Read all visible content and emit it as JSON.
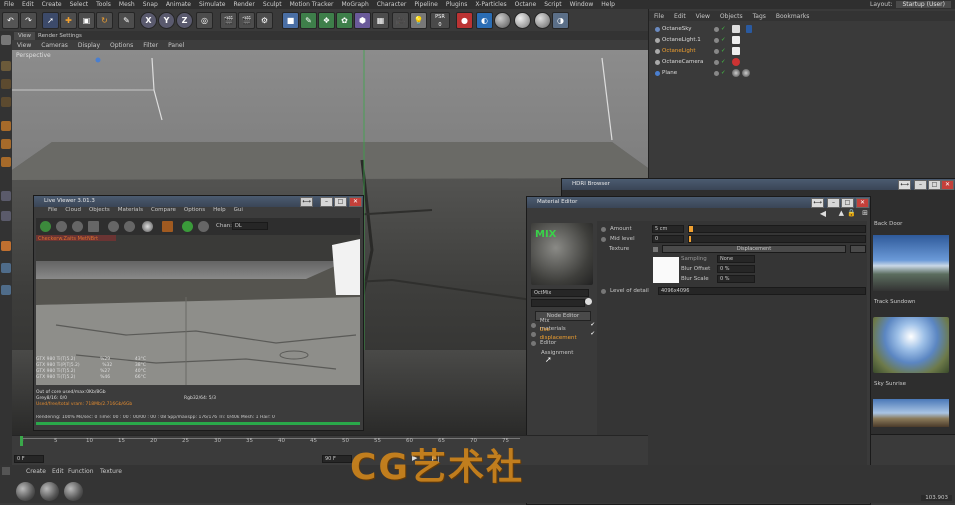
{
  "menubar": {
    "items": [
      "File",
      "Edit",
      "Create",
      "Select",
      "Tools",
      "Mesh",
      "Snap",
      "Animate",
      "Simulate",
      "Render",
      "Sculpt",
      "Motion Tracker",
      "MoGraph",
      "Character",
      "Pipeline",
      "Plugins",
      "X-Particles",
      "Octane",
      "Script",
      "Window",
      "Help"
    ],
    "layout_label": "Layout:",
    "layout_value": "Startup (User)"
  },
  "toolbar": {
    "axis_x": "X",
    "axis_y": "Y",
    "axis_z": "Z",
    "psr": "PSR",
    "psr_value": "0"
  },
  "viewport": {
    "tabs": [
      "View",
      "Render Settings"
    ],
    "menu": [
      "View",
      "Cameras",
      "Display",
      "Options",
      "Filter",
      "Panel"
    ],
    "label": "Perspective"
  },
  "object_manager": {
    "menu": [
      "File",
      "Edit",
      "View",
      "Objects",
      "Tags",
      "Bookmarks"
    ],
    "objects": [
      "OctaneSky",
      "OctaneLight.1",
      "OctaneLight",
      "OctaneCamera",
      "Plane"
    ]
  },
  "live_viewer": {
    "title": "Live Viewer 3.01.3",
    "menu": [
      "File",
      "Cloud",
      "Objects",
      "Materials",
      "Compare",
      "Options",
      "Help",
      "Gui"
    ],
    "channel_label": "Chan:",
    "channel_value": "DL",
    "header_text": "Checkerw.Zaits MetNBrt",
    "gpus": [
      {
        "name": "GTX 980 Ti(T|5.2)",
        "pct": "%29",
        "temp": "43°C"
      },
      {
        "name": "GTX 980 Ti(P|T|5.2)",
        "pct": "%32",
        "temp": "38°C"
      },
      {
        "name": "GTX 980 Ti(T|5.2)",
        "pct": "%27",
        "temp": "40°C"
      },
      {
        "name": "GTX 980 Ti(T|5.2)",
        "pct": "%46",
        "temp": "66°C"
      }
    ],
    "mem_line": "Out of core used/max:0Kb/8Gb",
    "grey_line": "Grey8/16: 0/0",
    "rgb_line": "Rgb32/64: 5/3",
    "vram_line": "Used/free/total vram: 718Mb/2.716Gb/6Gb",
    "render_status": "Rendering: 100%  Ms/sec: 0  Time: 00 : 00 : 00/00 : 00 : 08  Spp/maxspp: 176/176  Tri: 0/40k  Mesh: 1  Hair: 0"
  },
  "material_editor": {
    "title": "Material Editor",
    "thumb_label": "MIX",
    "mat_name": "OctMix",
    "node_editor": "Node Editor",
    "sections": [
      "Mix materials",
      "Use displacement",
      "Editor",
      "Assignment"
    ],
    "amount_label": "Amount",
    "amount_value": "5 cm",
    "mid_label": "Mid level",
    "mid_value": "0",
    "texture_label": "Texture",
    "texture_value": "Displacement",
    "sampling_label": "Sampling",
    "sampling_value": "None",
    "blur_offset_label": "Blur Offset",
    "blur_offset_value": "0 %",
    "blur_scale_label": "Blur Scale",
    "blur_scale_value": "0 %",
    "lod_label": "Level of detail",
    "lod_value": "4096x4096"
  },
  "hdri_browser": {
    "title": "HDRI Browser",
    "items": [
      "Back Door",
      "Track Sundown",
      "Sky Sunrise"
    ]
  },
  "timeline": {
    "ticks": [
      "0",
      "5",
      "10",
      "15",
      "20",
      "25",
      "30",
      "35",
      "40",
      "45",
      "50",
      "55",
      "60",
      "65",
      "70",
      "75"
    ],
    "start": "0 F",
    "end": "90 F"
  },
  "material_manager": {
    "menu": [
      "Create",
      "Edit",
      "Function",
      "Texture"
    ]
  },
  "watermark": "CG艺术社",
  "status_value": "103.903"
}
